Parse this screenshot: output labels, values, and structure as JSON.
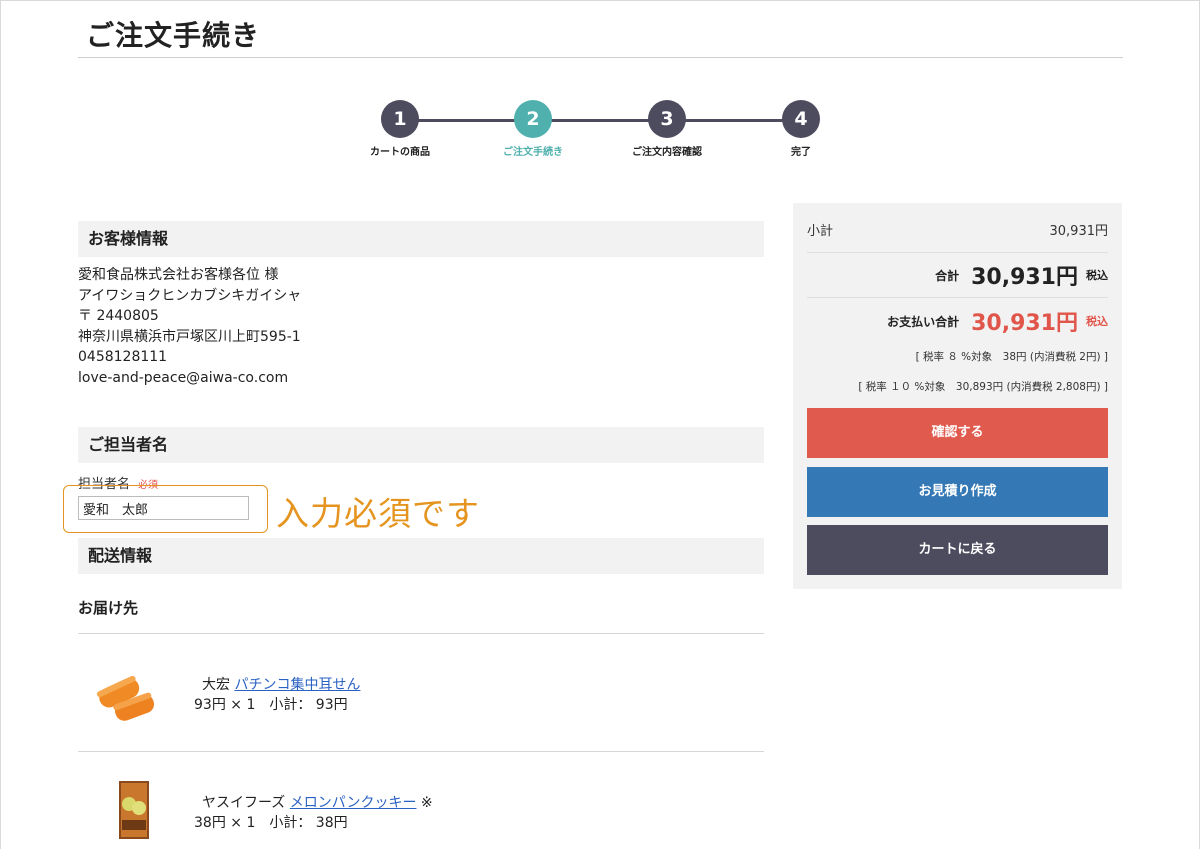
{
  "page": {
    "title": "ご注文手続き"
  },
  "steps": [
    {
      "number": "1",
      "label": "カートの商品",
      "active": false
    },
    {
      "number": "2",
      "label": "ご注文手続き",
      "active": true
    },
    {
      "number": "3",
      "label": "ご注文内容確認",
      "active": false
    },
    {
      "number": "4",
      "label": "完了",
      "active": false
    }
  ],
  "customer": {
    "heading": "お客様情報",
    "lines": [
      "愛和食品株式会社お客様各位 様",
      "アイワショクヒンカブシキガイシャ",
      "〒 2440805",
      "神奈川県横浜市戸塚区川上町595-1",
      "0458128111",
      "love-and-peace@aiwa-co.com"
    ]
  },
  "contact": {
    "heading": "ご担当者名",
    "field_label": "担当者名",
    "required": "必須",
    "value": "愛和　太郎",
    "annotation": "入力必須です"
  },
  "delivery": {
    "heading": "配送情報",
    "destination_label": "お届け先",
    "items": [
      {
        "maker": "大宏",
        "name": "パチンコ集中耳せん",
        "price_line": "93円 × 1　小計： 93円",
        "note": ""
      },
      {
        "maker": "ヤスイフーズ",
        "name": "メロンパンクッキー",
        "price_line": "38円 × 1　小計： 38円",
        "note": "※"
      }
    ]
  },
  "summary": {
    "subtotal_label": "小計",
    "subtotal_value": "30,931円",
    "total_label": "合計",
    "total_value": "30,931円",
    "tax_included": "税込",
    "payment_label": "お支払い合計",
    "payment_value": "30,931円",
    "tax8": "[ 税率 ８ %対象　38円 (内消費税 2円) ]",
    "tax10": "[ 税率 １０ %対象　30,893円 (内消費税 2,808円) ]",
    "confirm_button": "確認する",
    "quote_button": "お見積り作成",
    "back_button": "カートに戻る"
  },
  "colors": {
    "accent_teal": "#4fb0ad",
    "step_dark": "#4d4b5e",
    "confirm_red": "#e05b4e",
    "quote_blue": "#3478b5",
    "annotation_orange": "#e5951f"
  }
}
